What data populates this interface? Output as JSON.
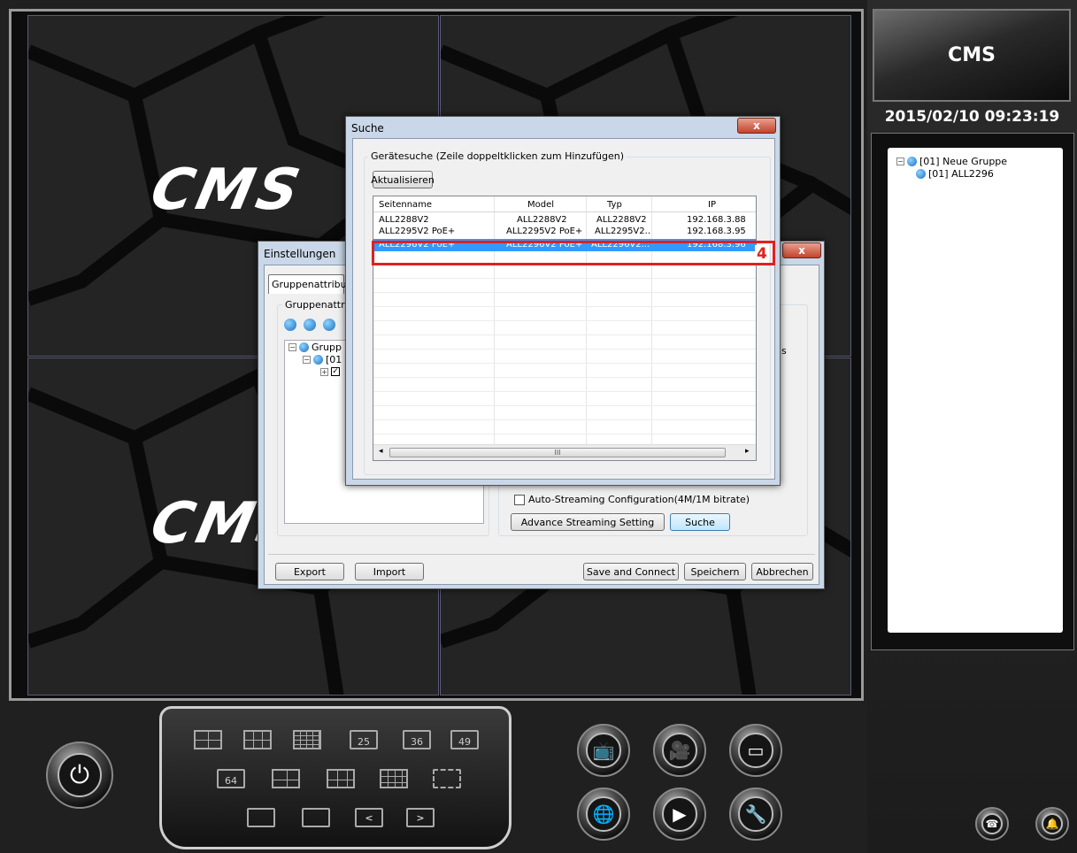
{
  "wall": {
    "logo_text": "CMS"
  },
  "side": {
    "badge": "CMS",
    "datetime": "2015/02/10 09:23:19",
    "tree": [
      {
        "label": "[01] Neue Gruppe"
      },
      {
        "label": "[01] ALL2296"
      }
    ]
  },
  "layout_panel": {
    "row1": [
      "",
      "",
      "",
      "25",
      "36",
      "49"
    ],
    "row2": [
      "64",
      "",
      "",
      "",
      ""
    ],
    "row3": [
      "",
      "",
      "<",
      ">"
    ]
  },
  "settings": {
    "title": "Einstellungen",
    "tab": "Gruppenattribute",
    "group_label": "Gruppenattribu",
    "tree": [
      "Grupp",
      "[01"
    ],
    "stray_text": "s",
    "auto_streaming": "Auto-Streaming Configuration(4M/1M bitrate)",
    "advance_btn": "Advance Streaming Setting",
    "suche_btn": "Suche",
    "export_btn": "Export",
    "import_btn": "Import",
    "save_connect_btn": "Save and Connect",
    "speichern_btn": "Speichern",
    "abbrechen_btn": "Abbrechen"
  },
  "search": {
    "title": "Suche",
    "group_label": "Gerätesuche (Zeile doppeltklicken zum Hinzufügen)",
    "refresh_btn": "Aktualisieren",
    "columns": [
      "Seitenname",
      "Model",
      "Typ",
      "IP"
    ],
    "rows": [
      {
        "name": "ALL2288V2",
        "model": "ALL2288V2",
        "type": "ALL2288V2",
        "ip": "192.168.3.88"
      },
      {
        "name": "ALL2295V2 PoE+",
        "model": "ALL2295V2 PoE+",
        "type": "ALL2295V2...",
        "ip": "192.168.3.95"
      },
      {
        "name": "ALL2296V2 PoE+",
        "model": "ALL2296V2 PoE+",
        "type": "ALL2296V2...",
        "ip": "192.168.3.96"
      }
    ],
    "selected_row": 2,
    "callout": "4",
    "scroll_mark": "III"
  }
}
